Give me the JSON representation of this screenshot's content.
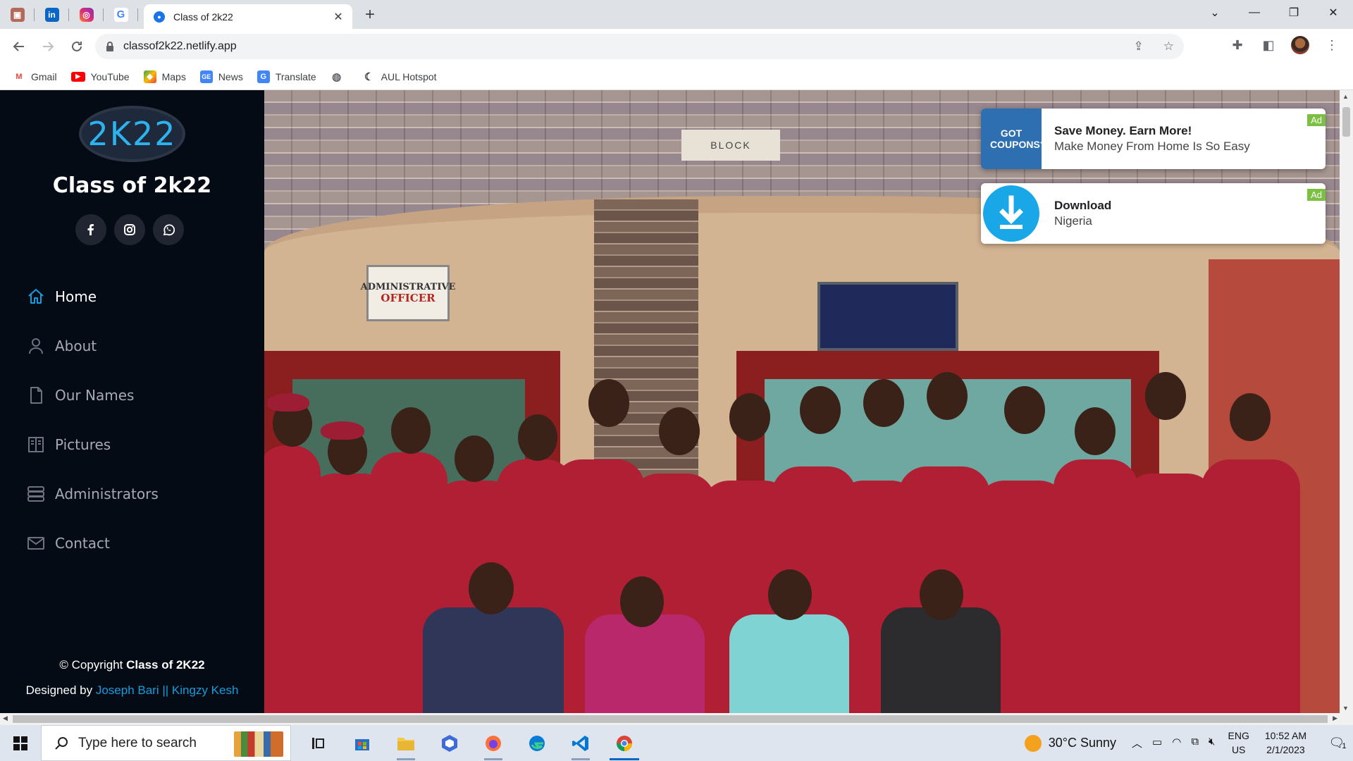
{
  "browser": {
    "pinned_tabs": [
      {
        "icon": "gmail-profile-icon",
        "color": "#c5221f"
      },
      {
        "icon": "linkedin-icon",
        "color": "#0a66c2"
      },
      {
        "icon": "instagram-icon",
        "color": "#e1306c"
      },
      {
        "icon": "google-icon",
        "color": "#4285f4"
      }
    ],
    "active_tab_title": "Class of 2k22",
    "new_tab_label": "+",
    "url": "classof2k22.netlify.app",
    "bookmarks": [
      {
        "label": "Gmail",
        "icon": "gmail-icon",
        "color": "#ea4335"
      },
      {
        "label": "YouTube",
        "icon": "youtube-icon",
        "color": "#ff0000"
      },
      {
        "label": "Maps",
        "icon": "maps-icon",
        "color": "#34a853"
      },
      {
        "label": "News",
        "icon": "news-icon",
        "color": "#4285f4"
      },
      {
        "label": "Translate",
        "icon": "translate-icon",
        "color": "#4285f4"
      },
      {
        "label": "",
        "icon": "globe-icon",
        "color": "#5f6368"
      },
      {
        "label": "AUL Hotspot",
        "icon": "aul-hotspot-icon",
        "color": "#333333"
      }
    ]
  },
  "site": {
    "logo_text": "2K22",
    "title": "Class of 2k22",
    "socials": [
      "facebook",
      "instagram",
      "whatsapp"
    ],
    "nav": [
      {
        "label": "Home",
        "icon": "home-icon",
        "active": true
      },
      {
        "label": "About",
        "icon": "person-icon",
        "active": false
      },
      {
        "label": "Our Names",
        "icon": "document-icon",
        "active": false
      },
      {
        "label": "Pictures",
        "icon": "book-icon",
        "active": false
      },
      {
        "label": "Administrators",
        "icon": "server-icon",
        "active": false
      },
      {
        "label": "Contact",
        "icon": "envelope-icon",
        "active": false
      }
    ],
    "copyright_prefix": "© Copyright",
    "copyright_name": "Class of 2K22",
    "designed_by": "Designed by",
    "designer_1": "Joseph Bari",
    "designer_sep": "||",
    "designer_2": "Kingzy Kesh",
    "accent_color": "#149ddd",
    "sidebar_color": "#040b14"
  },
  "hero_signs": {
    "block": "BLOCK",
    "admin_line1": "ADMINISTRATIVE",
    "admin_line2": "OFFICER"
  },
  "ads": [
    {
      "title": "Save Money. Earn More!",
      "subtitle": "Make Money From Home Is So Easy",
      "badge": "Ad",
      "image_text": "GOT COUPONS?"
    },
    {
      "title": "Download",
      "subtitle": "Nigeria",
      "badge": "Ad",
      "image_text": ""
    }
  ],
  "taskbar": {
    "search_placeholder": "Type here to search",
    "weather": "30°C  Sunny",
    "lang_line1": "ENG",
    "lang_line2": "US",
    "time": "10:52 AM",
    "date": "2/1/2023",
    "notifications": "1",
    "apps": [
      "task-view-icon",
      "store-icon",
      "file-explorer-icon",
      "app-icon",
      "firefox-icon",
      "edge-icon",
      "vscode-icon",
      "chrome-icon"
    ]
  }
}
